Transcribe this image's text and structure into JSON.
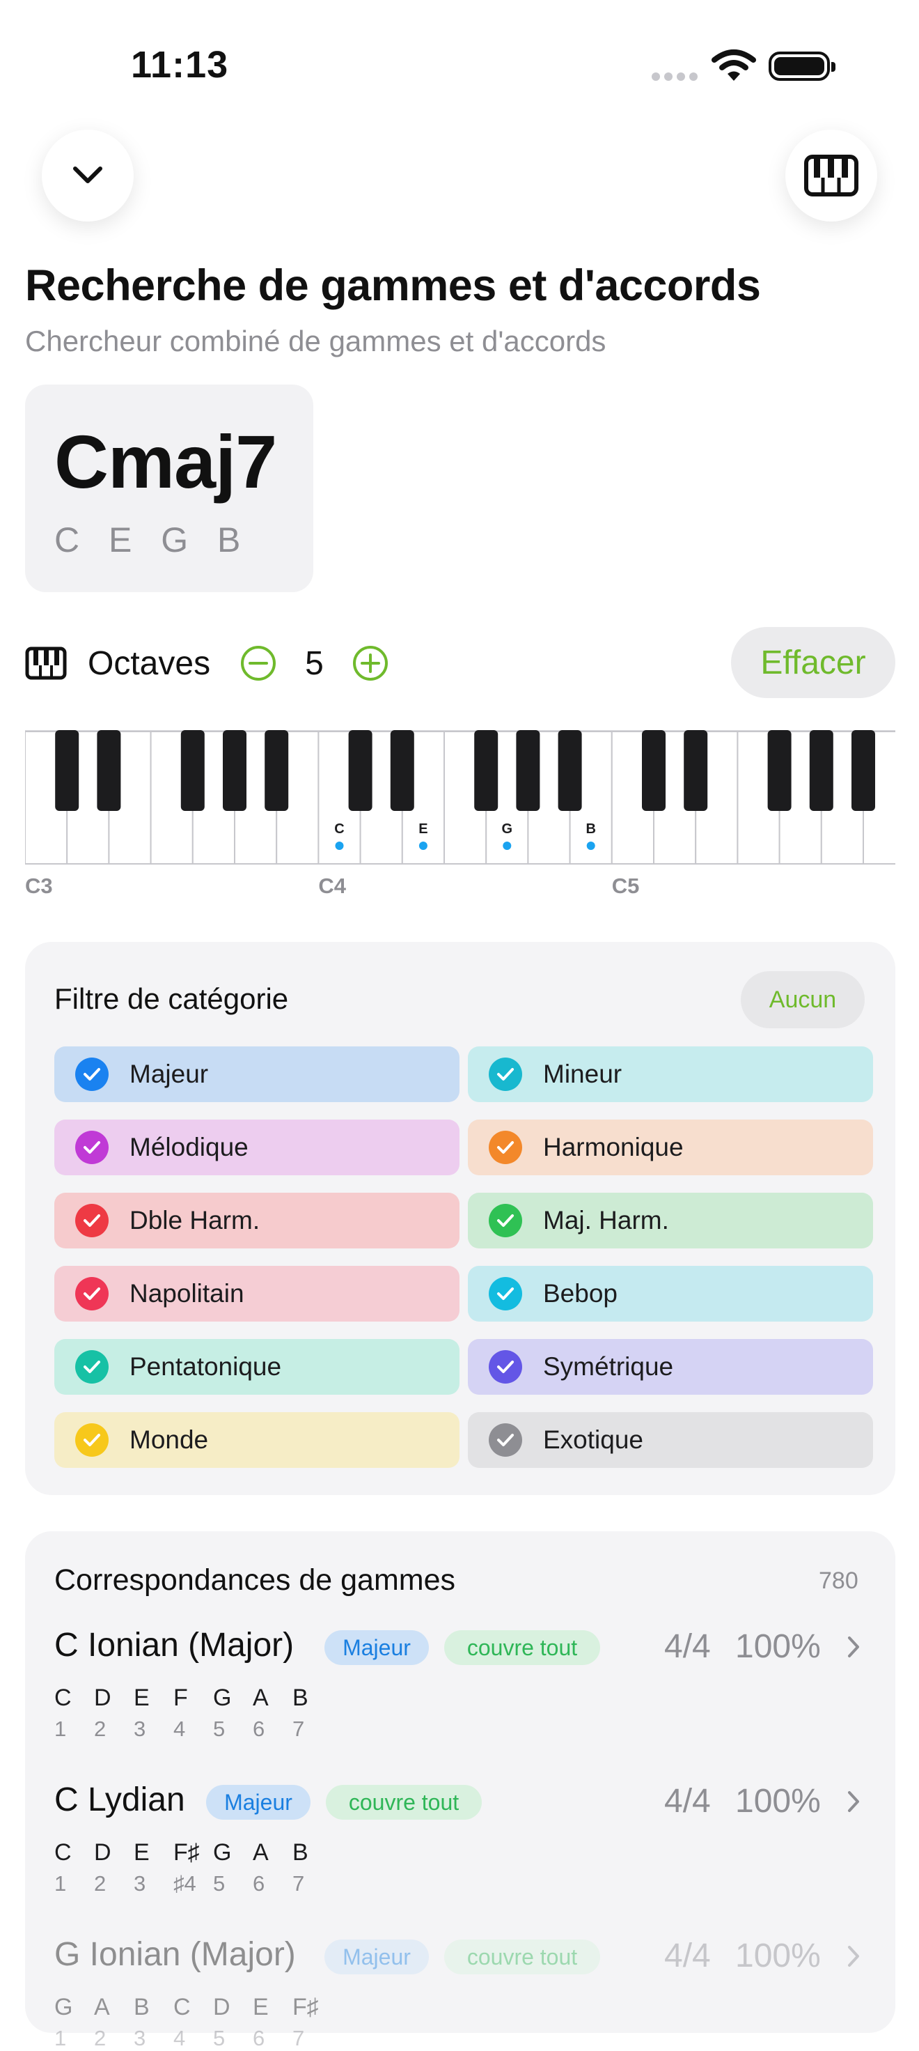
{
  "status": {
    "time": "11:13"
  },
  "header": {
    "title": "Recherche de gammes et d'accords",
    "subtitle": "Chercheur combiné de gammes et d'accords"
  },
  "chord": {
    "name": "Cmaj7",
    "notes": "C E G B"
  },
  "octaves": {
    "label": "Octaves",
    "value": "5",
    "clear_label": "Effacer"
  },
  "keyboard": {
    "octave_labels": [
      "C3",
      "C4",
      "C5"
    ],
    "selected_labels": [
      "C",
      "E",
      "G",
      "B"
    ],
    "accent": "#1aa3f0"
  },
  "filter": {
    "title": "Filtre de catégorie",
    "none_label": "Aucun",
    "categories": [
      {
        "label": "Majeur",
        "color": "#1a82f0",
        "bg": "#c7dcf4"
      },
      {
        "label": "Mineur",
        "color": "#18b8cf",
        "bg": "#c6ecee"
      },
      {
        "label": "Mélodique",
        "color": "#c03ad6",
        "bg": "#edcdef"
      },
      {
        "label": "Harmonique",
        "color": "#f3882a",
        "bg": "#f7dece"
      },
      {
        "label": "Dble Harm.",
        "color": "#ee3a44",
        "bg": "#f6cbcd"
      },
      {
        "label": "Maj. Harm.",
        "color": "#2fc154",
        "bg": "#cdebd4"
      },
      {
        "label": "Napolitain",
        "color": "#ef3656",
        "bg": "#f5cdd4"
      },
      {
        "label": "Bebop",
        "color": "#13bce0",
        "bg": "#c5eaf0"
      },
      {
        "label": "Pentatonique",
        "color": "#17c1a5",
        "bg": "#c6eee4"
      },
      {
        "label": "Symétrique",
        "color": "#6356e6",
        "bg": "#d5d3f4"
      },
      {
        "label": "Monde",
        "color": "#f7c81b",
        "bg": "#f6edc6"
      },
      {
        "label": "Exotique",
        "color": "#8e8e93",
        "bg": "#e2e2e4"
      }
    ]
  },
  "matches": {
    "title": "Correspondances de gammes",
    "count": "780",
    "items": [
      {
        "name": "C Ionian (Major)",
        "category": "Majeur",
        "coverage": "couvre tout",
        "score": "4/4",
        "percent": "100%",
        "notes": [
          "C",
          "D",
          "E",
          "F",
          "G",
          "A",
          "B"
        ],
        "degrees": [
          "1",
          "2",
          "3",
          "4",
          "5",
          "6",
          "7"
        ]
      },
      {
        "name": "C Lydian",
        "category": "Majeur",
        "coverage": "couvre tout",
        "score": "4/4",
        "percent": "100%",
        "notes": [
          "C",
          "D",
          "E",
          "F♯",
          "G",
          "A",
          "B"
        ],
        "degrees": [
          "1",
          "2",
          "3",
          "♯4",
          "5",
          "6",
          "7"
        ]
      },
      {
        "name": "G Ionian (Major)",
        "category": "Majeur",
        "coverage": "couvre tout",
        "score": "4/4",
        "percent": "100%",
        "notes": [
          "G",
          "A",
          "B",
          "C",
          "D",
          "E",
          "F♯"
        ],
        "degrees": [
          "1",
          "2",
          "3",
          "4",
          "5",
          "6",
          "7"
        ]
      }
    ]
  }
}
